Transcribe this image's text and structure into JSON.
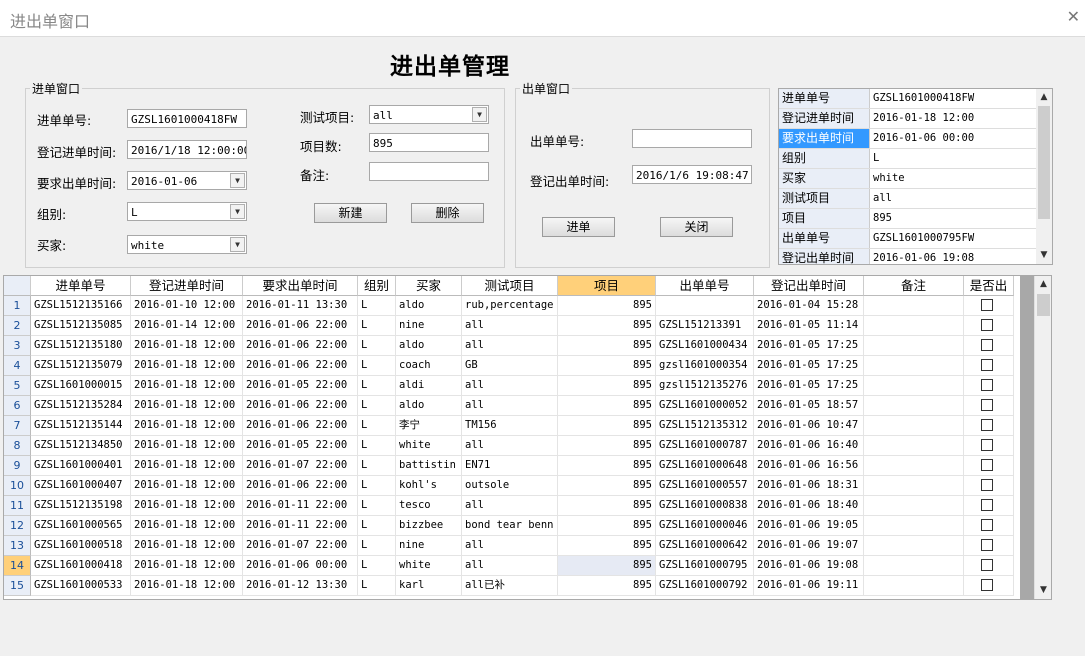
{
  "window": {
    "title": "进出单窗口",
    "close_glyph": "✕"
  },
  "heading": "进出单管理",
  "in_panel": {
    "legend": "进单窗口",
    "fields": {
      "order_no_label": "进单单号:",
      "order_no": "GZSL1601000418FW",
      "reg_time_label": "登记进单时间:",
      "reg_time": "2016/1/18 12:00:00",
      "req_out_label": "要求出单时间:",
      "req_out": "2016-01-06",
      "group_label": "组别:",
      "group": "L",
      "buyer_label": "买家:",
      "buyer": "white",
      "test_item_label": "测试项目:",
      "test_item": "all",
      "item_count_label": "项目数:",
      "item_count": "895",
      "note_label": "备注:",
      "note": ""
    },
    "buttons": {
      "new": "新建",
      "delete": "删除"
    }
  },
  "out_panel": {
    "legend": "出单窗口",
    "fields": {
      "out_no_label": "出单单号:",
      "out_no": "",
      "out_time_label": "登记出单时间:",
      "out_time": "2016/1/6 19:08:47"
    },
    "buttons": {
      "in": "进单",
      "close": "关闭"
    }
  },
  "property_panel": {
    "rows": [
      {
        "key": "进单单号",
        "value": "GZSL1601000418FW"
      },
      {
        "key": "登记进单时间",
        "value": "2016-01-18 12:00"
      },
      {
        "key": "要求出单时间",
        "value": "2016-01-06 00:00"
      },
      {
        "key": "组别",
        "value": "L"
      },
      {
        "key": "买家",
        "value": "white"
      },
      {
        "key": "测试项目",
        "value": "all"
      },
      {
        "key": "项目",
        "value": "895"
      },
      {
        "key": "出单单号",
        "value": "GZSL1601000795FW"
      },
      {
        "key": "登记出单时间",
        "value": "2016-01-06 19:08"
      }
    ],
    "selected_row": 2
  },
  "grid": {
    "columns": [
      "进单单号",
      "登记进单时间",
      "要求出单时间",
      "组别",
      "买家",
      "测试项目",
      "项目",
      "出单单号",
      "登记出单时间",
      "备注",
      "是否出"
    ],
    "highlight_column": 6,
    "selected_row": 13,
    "rows": [
      {
        "n": "1",
        "c": [
          "GZSL1512135166",
          "2016-01-10 12:00",
          "2016-01-11 13:30",
          "L",
          "aldo",
          "rub,percentage",
          "895",
          "",
          "2016-01-04 15:28",
          ""
        ]
      },
      {
        "n": "2",
        "c": [
          "GZSL1512135085",
          "2016-01-14 12:00",
          "2016-01-06 22:00",
          "L",
          "nine",
          "all",
          "895",
          "GZSL151213391",
          "2016-01-05 11:14",
          ""
        ]
      },
      {
        "n": "3",
        "c": [
          "GZSL1512135180",
          "2016-01-18 12:00",
          "2016-01-06 22:00",
          "L",
          "aldo",
          "all",
          "895",
          "GZSL1601000434",
          "2016-01-05 17:25",
          ""
        ]
      },
      {
        "n": "4",
        "c": [
          "GZSL1512135079",
          "2016-01-18 12:00",
          "2016-01-06 22:00",
          "L",
          "coach",
          "GB",
          "895",
          "gzsl1601000354",
          "2016-01-05 17:25",
          ""
        ]
      },
      {
        "n": "5",
        "c": [
          "GZSL1601000015",
          "2016-01-18 12:00",
          "2016-01-05 22:00",
          "L",
          "aldi",
          "all",
          "895",
          "gzsl1512135276",
          "2016-01-05 17:25",
          ""
        ]
      },
      {
        "n": "6",
        "c": [
          "GZSL1512135284",
          "2016-01-18 12:00",
          "2016-01-06 22:00",
          "L",
          "aldo",
          "all",
          "895",
          "GZSL1601000052",
          "2016-01-05 18:57",
          ""
        ]
      },
      {
        "n": "7",
        "c": [
          "GZSL1512135144",
          "2016-01-18 12:00",
          "2016-01-06 22:00",
          "L",
          "李宁",
          "TM156",
          "895",
          "GZSL1512135312",
          "2016-01-06 10:47",
          ""
        ]
      },
      {
        "n": "8",
        "c": [
          "GZSL1512134850",
          "2016-01-18 12:00",
          "2016-01-05 22:00",
          "L",
          "white",
          "all",
          "895",
          "GZSL1601000787",
          "2016-01-06 16:40",
          ""
        ]
      },
      {
        "n": "9",
        "c": [
          "GZSL1601000401",
          "2016-01-18 12:00",
          "2016-01-07 22:00",
          "L",
          "battistin",
          "EN71",
          "895",
          "GZSL1601000648",
          "2016-01-06 16:56",
          ""
        ]
      },
      {
        "n": "10",
        "c": [
          "GZSL1601000407",
          "2016-01-18 12:00",
          "2016-01-06 22:00",
          "L",
          "kohl's",
          "outsole",
          "895",
          "GZSL1601000557",
          "2016-01-06 18:31",
          ""
        ]
      },
      {
        "n": "11",
        "c": [
          "GZSL1512135198",
          "2016-01-18 12:00",
          "2016-01-11 22:00",
          "L",
          "tesco",
          "all",
          "895",
          "GZSL1601000838",
          "2016-01-06 18:40",
          ""
        ]
      },
      {
        "n": "12",
        "c": [
          "GZSL1601000565",
          "2016-01-18 12:00",
          "2016-01-11 22:00",
          "L",
          "bizzbee",
          "bond tear benn",
          "895",
          "GZSL1601000046",
          "2016-01-06 19:05",
          ""
        ]
      },
      {
        "n": "13",
        "c": [
          "GZSL1601000518",
          "2016-01-18 12:00",
          "2016-01-07 22:00",
          "L",
          "nine",
          "all",
          "895",
          "GZSL1601000642",
          "2016-01-06 19:07",
          ""
        ]
      },
      {
        "n": "14",
        "c": [
          "GZSL1601000418",
          "2016-01-18 12:00",
          "2016-01-06 00:00",
          "L",
          "white",
          "all",
          "895",
          "GZSL1601000795",
          "2016-01-06 19:08",
          ""
        ]
      },
      {
        "n": "15",
        "c": [
          "GZSL1601000533",
          "2016-01-18 12:00",
          "2016-01-12 13:30",
          "L",
          "karl",
          "all已补",
          "895",
          "GZSL1601000792",
          "2016-01-06 19:11",
          ""
        ]
      }
    ]
  }
}
